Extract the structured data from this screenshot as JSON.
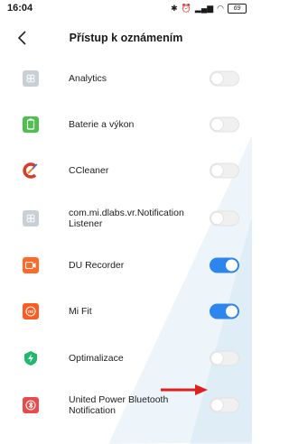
{
  "status_bar": {
    "time": "16:04",
    "battery": "69"
  },
  "header": {
    "title": "Přístup k oznámením"
  },
  "apps": [
    {
      "name": "Analytics",
      "enabled": false,
      "icon": "generic-app-icon",
      "color": "#c9cfd6"
    },
    {
      "name": "Baterie a výkon",
      "enabled": false,
      "icon": "battery-icon",
      "color": "#4cc14d"
    },
    {
      "name": "CCleaner",
      "enabled": false,
      "icon": "ccleaner-icon",
      "color": "#d83a2c"
    },
    {
      "name": "com.mi.dlabs.vr.Notification Listener",
      "enabled": false,
      "icon": "generic-app-icon",
      "color": "#c9cfd6"
    },
    {
      "name": "DU Recorder",
      "enabled": true,
      "icon": "camera-icon",
      "color": "#ff6a2b"
    },
    {
      "name": "Mi Fit",
      "enabled": true,
      "icon": "mi-fit-icon",
      "color": "#ff5a1f"
    },
    {
      "name": "Optimalizace",
      "enabled": false,
      "icon": "lightning-icon",
      "color": "#1fb86e"
    },
    {
      "name": "United Power Bluetooth Notification",
      "enabled": false,
      "icon": "bluetooth-icon",
      "color": "#e94b4b"
    }
  ],
  "colors": {
    "toggle_on": "#2d85ee",
    "annotation_arrow": "#e01e1e"
  }
}
